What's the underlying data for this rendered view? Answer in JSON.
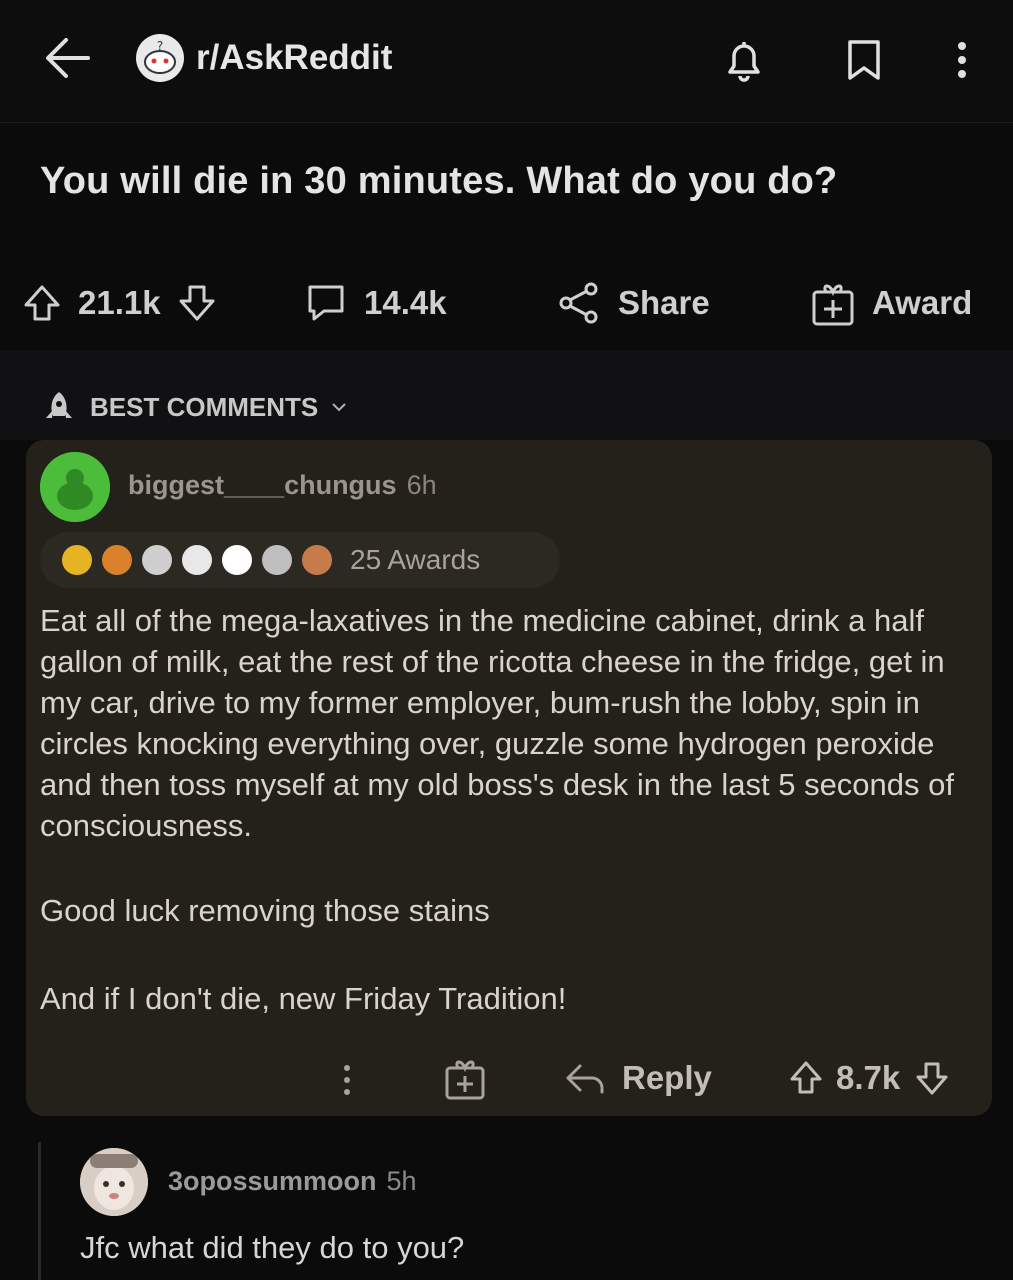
{
  "header": {
    "subreddit": "r/AskReddit",
    "icons": [
      "back-arrow-icon",
      "subreddit-avatar-icon",
      "bell-icon",
      "bookmark-icon",
      "more-vertical-icon"
    ]
  },
  "post": {
    "title": "You will die in 30 minutes. What do you do?",
    "upvotes": "21.1k",
    "comments": "14.4k",
    "share_label": "Share",
    "award_label": "Award"
  },
  "sort": {
    "label": "BEST COMMENTS"
  },
  "comment": {
    "username": "biggest____chungus",
    "age": "6h",
    "awards_label": "25 Awards",
    "award_colors": [
      "#e6b422",
      "#d9822b",
      "#cfcfcf",
      "#e8e8e8",
      "#ffffff",
      "#bfbfbf",
      "#c77b4a"
    ],
    "paragraph_1": "Eat all of the mega-laxatives in the medicine cabinet, drink a half gallon of milk, eat the rest of the ricotta cheese in the fridge, get in my car, drive to my former employer, bum-rush the lobby, spin in circles knocking everything over, guzzle some hydrogen peroxide and then toss myself at my old boss's desk in the last 5 seconds of consciousness.",
    "paragraph_2": "Good luck removing those stains",
    "paragraph_3": "And if I don't die, new Friday Tradition!",
    "reply_label": "Reply",
    "votes": "8.7k"
  },
  "reply": {
    "username": "3opossummoon",
    "age": "5h",
    "text": "Jfc what did they do to you?"
  },
  "colors": {
    "background": "#0b0b0c",
    "comment_card": "#24211b",
    "avatar_green": "#4bbd3a"
  }
}
